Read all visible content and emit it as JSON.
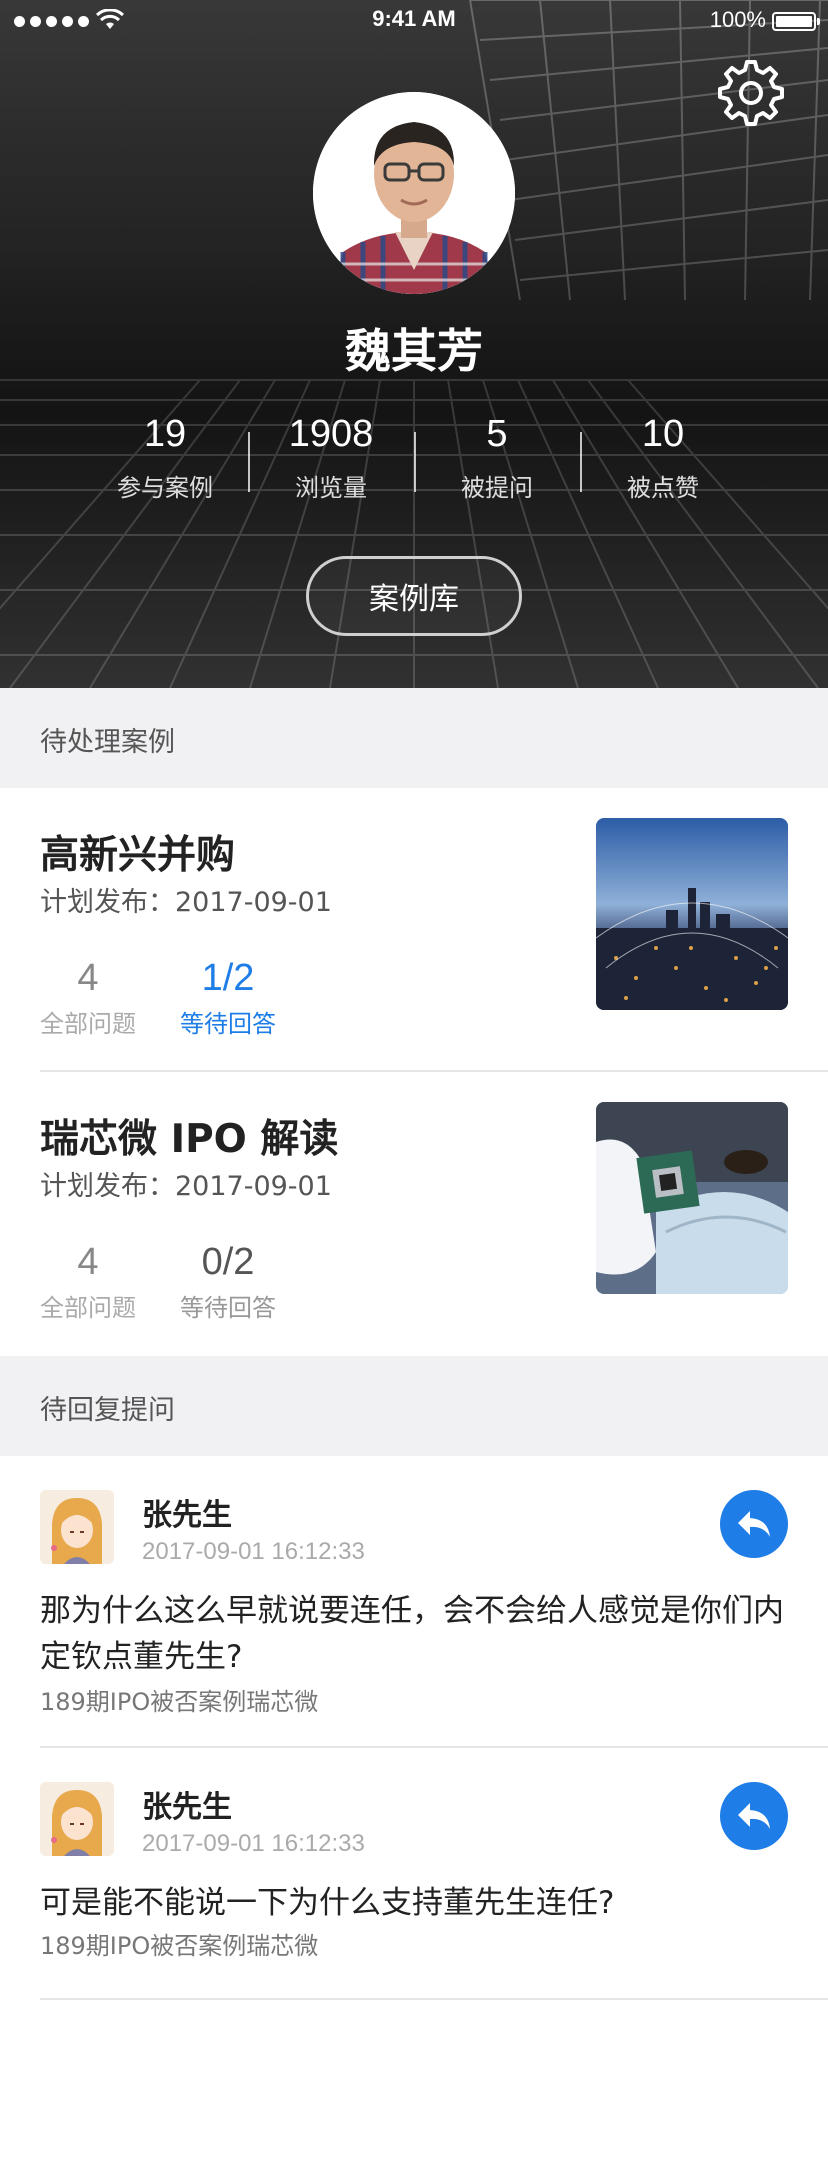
{
  "status_bar": {
    "time": "9:41 AM",
    "battery": "100%"
  },
  "profile": {
    "name": "魏其芳",
    "stats": [
      {
        "value": "19",
        "label": "参与案例"
      },
      {
        "value": "1908",
        "label": "浏览量"
      },
      {
        "value": "5",
        "label": "被提问"
      },
      {
        "value": "10",
        "label": "被点赞"
      }
    ],
    "library_button": "案例库"
  },
  "pending_cases": {
    "header": "待处理案例",
    "items": [
      {
        "title": "高新兴并购",
        "date": "计划发布：2017-09-01",
        "total": "4",
        "total_label": "全部问题",
        "waiting": "1/2",
        "waiting_label": "等待回答"
      },
      {
        "title": "瑞芯微 IPO 解读",
        "date": "计划发布：2017-09-01",
        "total": "4",
        "total_label": "全部问题",
        "waiting": "0/2",
        "waiting_label": "等待回答"
      }
    ]
  },
  "pending_questions": {
    "header": "待回复提问",
    "items": [
      {
        "name": "张先生",
        "time": "2017-09-01 16:12:33",
        "text": "那为什么这么早就说要连任，会不会给人感觉是你们内定钦点董先生?",
        "source": "189期IPO被否案例瑞芯微"
      },
      {
        "name": "张先生",
        "time": "2017-09-01 16:12:33",
        "text": "可是能不能说一下为什么支持董先生连任?",
        "source": "189期IPO被否案例瑞芯微"
      }
    ]
  },
  "icons": {
    "settings": "gear-icon",
    "reply": "reply-arrow-icon",
    "wifi": "wifi-icon",
    "battery": "battery-icon"
  },
  "colors": {
    "accent": "#1e7de6",
    "section_bg": "#f1f1f4"
  }
}
